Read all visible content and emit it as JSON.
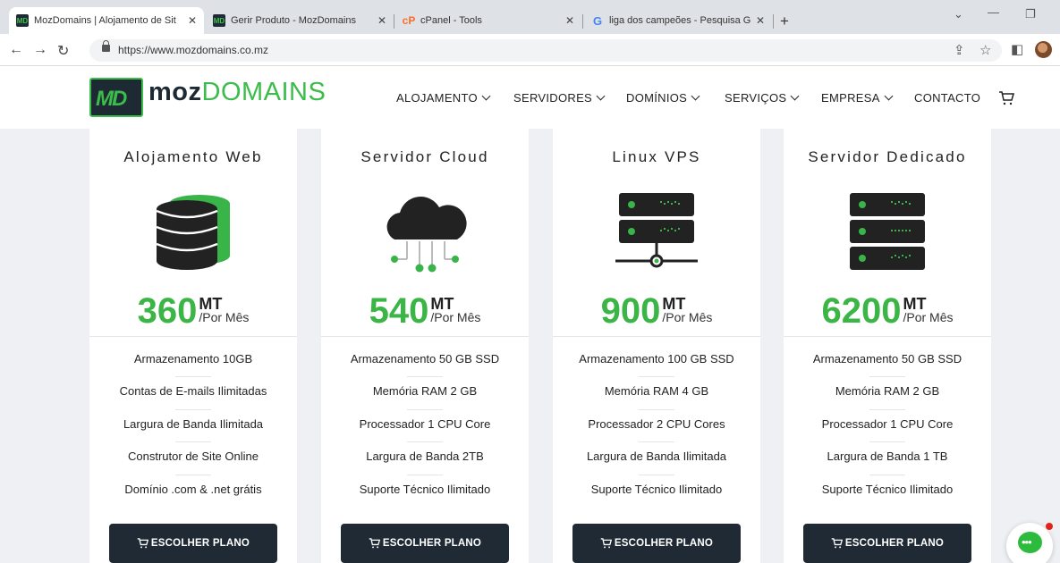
{
  "browser": {
    "tabs": [
      {
        "title": "MozDomains | Alojamento de Sit",
        "favicon": "mozdomains-favicon",
        "active": true
      },
      {
        "title": "Gerir Produto - MozDomains",
        "favicon": "mozdomains-favicon",
        "active": false
      },
      {
        "title": "cPanel - Tools",
        "favicon": "cpanel-favicon",
        "active": false
      },
      {
        "title": "liga dos campeões - Pesquisa Go",
        "favicon": "google-favicon",
        "active": false
      }
    ],
    "url": "https://www.mozdomains.co.mz"
  },
  "site": {
    "logo": {
      "part1": "moz",
      "part2": "DOMAINS"
    },
    "nav": [
      "ALOJAMENTO",
      "SERVIDORES",
      "DOMÍNIOS",
      "SERVIÇOS",
      "EMPRESA",
      "CONTACTO"
    ],
    "brand_color": "#3cb547",
    "dark_color": "#1f2a35"
  },
  "plans": [
    {
      "title": "Alojamento Web",
      "icon": "database-icon",
      "price": "360",
      "currency": "MT",
      "period": "/Por Mês",
      "features": [
        "Armazenamento 10GB",
        "Contas de E-mails Ilimitadas",
        "Largura de Banda Ilimitada",
        "Construtor de Site Online",
        "Domínio .com & .net grátis"
      ],
      "button": "ESCOLHER PLANO"
    },
    {
      "title": "Servidor Cloud",
      "icon": "cloud-network-icon",
      "price": "540",
      "currency": "MT",
      "period": "/Por Mês",
      "features": [
        "Armazenamento 50 GB SSD",
        "Memória RAM 2 GB",
        "Processador 1 CPU Core",
        "Largura de Banda 2TB",
        "Suporte Técnico Ilimitado"
      ],
      "button": "ESCOLHER PLANO"
    },
    {
      "title": "Linux VPS",
      "icon": "vps-server-icon",
      "price": "900",
      "currency": "MT",
      "period": "/Por Mês",
      "features": [
        "Armazenamento 100 GB SSD",
        "Memória RAM 4 GB",
        "Processador 2 CPU Cores",
        "Largura de Banda Ilimitada",
        "Suporte Técnico Ilimitado"
      ],
      "button": "ESCOLHER PLANO"
    },
    {
      "title": "Servidor Dedicado",
      "icon": "dedicated-server-icon",
      "price": "6200",
      "currency": "MT",
      "period": "/Por Mês",
      "features": [
        "Armazenamento 50 GB SSD",
        "Memória RAM 2 GB",
        "Processador 1 CPU Core",
        "Largura de Banda 1 TB",
        "Suporte Técnico Ilimitado"
      ],
      "button": "ESCOLHER PLANO"
    }
  ]
}
